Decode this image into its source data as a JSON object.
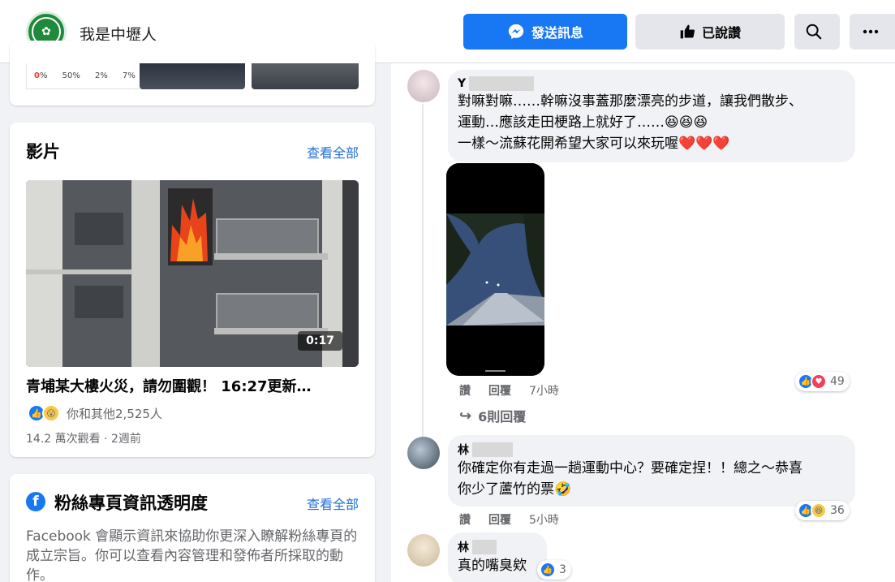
{
  "header": {
    "page_name": "我是中壢人",
    "send_message_label": "發送訊息",
    "liked_label": "已說讚",
    "icons": {
      "messenger": "messenger-icon",
      "thumb": "thumbs-up-icon",
      "search": "search-icon",
      "more": "more-icon"
    }
  },
  "top_card": {
    "stats": [
      {
        "value": "0",
        "unit": "%"
      },
      {
        "value": "50",
        "unit": "%"
      },
      {
        "value": "2",
        "unit": "%"
      },
      {
        "value": "7",
        "unit": "%"
      }
    ]
  },
  "videos": {
    "title": "影片",
    "see_all": "查看全部",
    "duration": "0:17",
    "video_title": "青埔某大樓火災，請勿圍觀！ 16:27更新…",
    "reactions_text": "你和其他2,525人",
    "views_text": "14.2 萬次觀看 · 2週前"
  },
  "transparency": {
    "title": "粉絲專頁資訊透明度",
    "see_all": "查看全部",
    "text": "Facebook 會顯示資訊來協助你更深入瞭解粉絲專頁的成立宗旨。你可以查看內容管理和發佈者所採取的動作。"
  },
  "comments": [
    {
      "name_initial": "Y",
      "lines": [
        "對嘛對嘛……幹嘛沒事蓋那麼漂亮的步道，讓我們散步、",
        "運動…應該走田梗路上就好了……😆😆😆",
        "一樣～流蘇花開希望大家可以來玩喔❤️❤️❤️"
      ],
      "like": "讚",
      "reply": "回覆",
      "time": "7小時",
      "reaction_count": "49",
      "replies_label": "6則回覆"
    },
    {
      "name_initial": "林",
      "lines": [
        "你確定你有走過一趟運動中心？要確定捏！！總之～恭喜",
        "你少了蘆竹的票🤣"
      ],
      "like": "讚",
      "reply": "回覆",
      "time": "5小時",
      "reaction_count": "36"
    },
    {
      "name_initial": "林",
      "lines": [
        "真的嘴臭欸"
      ],
      "reaction_count": "3"
    }
  ],
  "colors": {
    "primary": "#1877f2",
    "bubble": "#f0f2f5",
    "secondary_text": "#65676b"
  }
}
